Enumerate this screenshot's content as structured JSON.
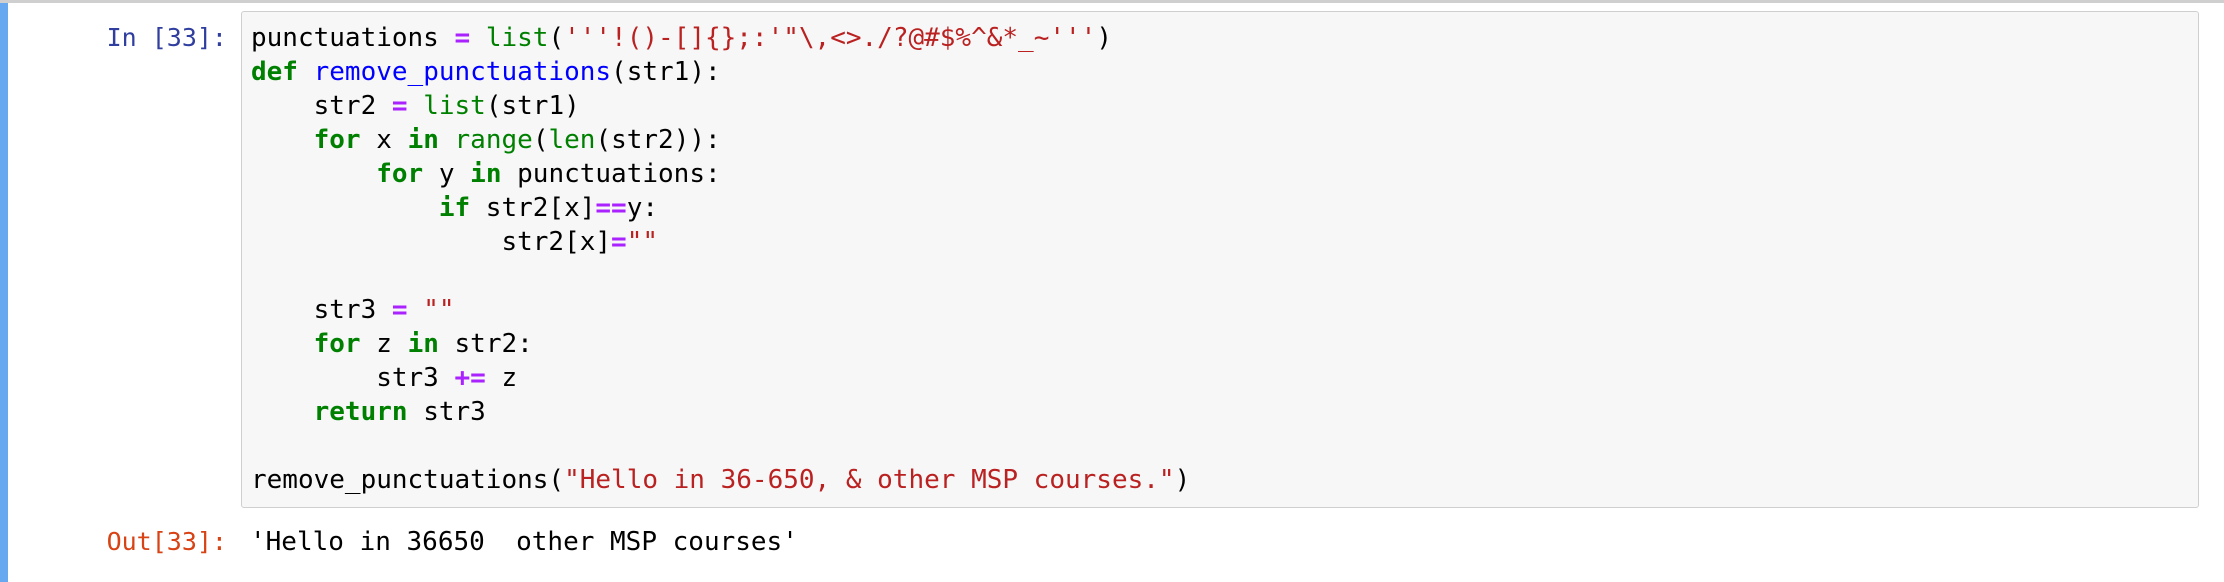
{
  "cell": {
    "in_prompt": "In [33]:",
    "out_prompt": "Out[33]:",
    "output_text": "'Hello in 36650  other MSP courses'",
    "code_lines": [
      [
        [
          "t",
          "punctuations "
        ],
        [
          "op",
          "="
        ],
        [
          "t",
          " "
        ],
        [
          "bi",
          "list"
        ],
        [
          "t",
          "("
        ],
        [
          "st",
          "'''!()-[]{};:'\"\\,<>./?@#$%^&*_~'''"
        ],
        [
          "t",
          ")"
        ]
      ],
      [
        [
          "kw",
          "def"
        ],
        [
          "t",
          " "
        ],
        [
          "fn",
          "remove_punctuations"
        ],
        [
          "t",
          "(str1):"
        ]
      ],
      [
        [
          "t",
          "    str2 "
        ],
        [
          "op",
          "="
        ],
        [
          "t",
          " "
        ],
        [
          "bi",
          "list"
        ],
        [
          "t",
          "(str1)"
        ]
      ],
      [
        [
          "t",
          "    "
        ],
        [
          "kw",
          "for"
        ],
        [
          "t",
          " x "
        ],
        [
          "kw",
          "in"
        ],
        [
          "t",
          " "
        ],
        [
          "bi",
          "range"
        ],
        [
          "t",
          "("
        ],
        [
          "bi",
          "len"
        ],
        [
          "t",
          "(str2)):"
        ]
      ],
      [
        [
          "t",
          "        "
        ],
        [
          "kw",
          "for"
        ],
        [
          "t",
          " y "
        ],
        [
          "kw",
          "in"
        ],
        [
          "t",
          " punctuations:"
        ]
      ],
      [
        [
          "t",
          "            "
        ],
        [
          "kw",
          "if"
        ],
        [
          "t",
          " str2[x]"
        ],
        [
          "op",
          "=="
        ],
        [
          "t",
          "y:"
        ]
      ],
      [
        [
          "t",
          "                str2[x]"
        ],
        [
          "op",
          "="
        ],
        [
          "st",
          "\"\""
        ]
      ],
      [],
      [
        [
          "t",
          "    str3 "
        ],
        [
          "op",
          "="
        ],
        [
          "t",
          " "
        ],
        [
          "st",
          "\"\""
        ]
      ],
      [
        [
          "t",
          "    "
        ],
        [
          "kw",
          "for"
        ],
        [
          "t",
          " z "
        ],
        [
          "kw",
          "in"
        ],
        [
          "t",
          " str2:"
        ]
      ],
      [
        [
          "t",
          "        str3 "
        ],
        [
          "op",
          "+="
        ],
        [
          "t",
          " z"
        ]
      ],
      [
        [
          "t",
          "    "
        ],
        [
          "kw",
          "return"
        ],
        [
          "t",
          " str3"
        ]
      ],
      [],
      [
        [
          "t",
          "remove_punctuations("
        ],
        [
          "st",
          "\"Hello in 36-650, & other MSP courses.\""
        ],
        [
          "t",
          ")"
        ]
      ]
    ]
  },
  "colors": {
    "in_prompt": "#303F9F",
    "out_prompt": "#D84315",
    "keyword": "#008000",
    "function_name": "#0000FF",
    "string": "#BA2121",
    "operator": "#AA22FF",
    "selected_cell_bar": "#66a9f1"
  }
}
